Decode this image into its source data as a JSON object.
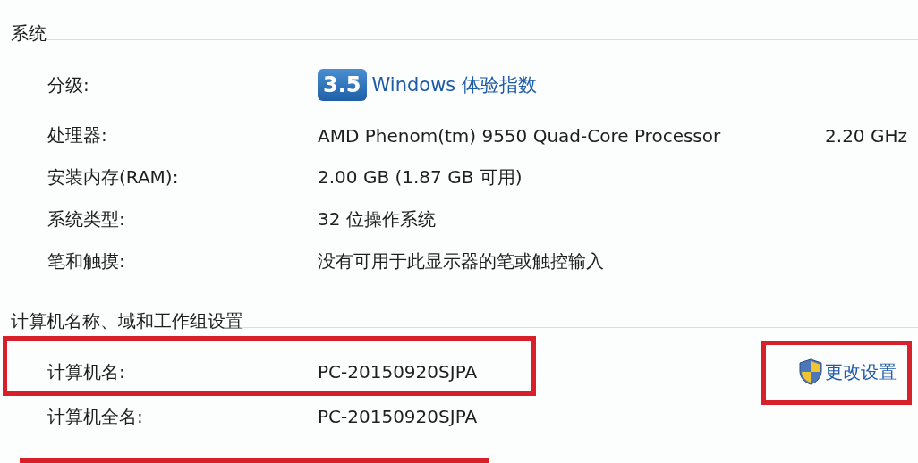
{
  "system": {
    "heading": "系统",
    "rating": {
      "label": "分级:",
      "score": "3.5",
      "link": "Windows 体验指数"
    },
    "rows": [
      {
        "label": "处理器:",
        "value": "AMD Phenom(tm) 9550 Quad-Core Processor",
        "value_2": "2.20 GHz"
      },
      {
        "label": "安装内存(RAM):",
        "value": "2.00 GB (1.87 GB 可用)"
      },
      {
        "label": "系统类型:",
        "value": "32 位操作系统"
      },
      {
        "label": "笔和触摸:",
        "value": "没有可用于此显示器的笔或触控输入"
      }
    ]
  },
  "computer": {
    "heading": "计算机名称、域和工作组设置",
    "rows": [
      {
        "label": "计算机名:",
        "value": "PC-20150920SJPA",
        "highlighted": true,
        "action": {
          "label": "更改设置",
          "highlighted": true
        }
      },
      {
        "label": "计算机全名:",
        "value": "PC-20150920SJPA",
        "highlighted": false
      }
    ]
  }
}
